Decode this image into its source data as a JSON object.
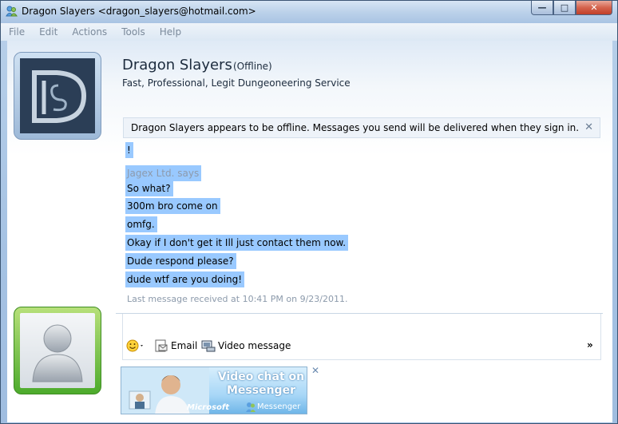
{
  "window": {
    "title": "Dragon Slayers <dragon_slayers@hotmail.com>",
    "controls": {
      "minimize": "—",
      "maximize": "□",
      "close": "✕"
    }
  },
  "menu": [
    "File",
    "Edit",
    "Actions",
    "Tools",
    "Help"
  ],
  "contact": {
    "name": "Dragon Slayers",
    "status": "(Offline)",
    "personal_message": "Fast, Professional, Legit Dungeoneering Service",
    "avatar_icon": "dragon-slayers-logo-icon"
  },
  "notice": {
    "text": "Dragon Slayers appears to be offline. Messages you send will be delivered when they sign in.",
    "close_icon": "close-icon"
  },
  "conversation": {
    "lines": [
      {
        "text": "!",
        "kind": "message"
      },
      {
        "text": "Jagex Ltd. says",
        "kind": "sender"
      },
      {
        "text": "So what?",
        "kind": "message"
      },
      {
        "text": "300m bro come on",
        "kind": "message"
      },
      {
        "text": "omfg.",
        "kind": "message"
      },
      {
        "text": "Okay if I don't get it Ill just contact them now.",
        "kind": "message"
      },
      {
        "text": "Dude respond please?",
        "kind": "message"
      },
      {
        "text": "dude wtf are you doing!",
        "kind": "message"
      }
    ],
    "selection_color": "#99c9ff",
    "last_received": "Last message received at 10:41 PM on 9/23/2011."
  },
  "compose_toolbar": {
    "emoticon_icon": "smiley-icon",
    "email_label": "Email",
    "video_label": "Video message",
    "more_label": "»"
  },
  "ad": {
    "headline_line1": "Video chat on",
    "headline_line2": "Messenger",
    "brand": "Microsoft",
    "logo_text": "Messenger",
    "close": "✕"
  }
}
